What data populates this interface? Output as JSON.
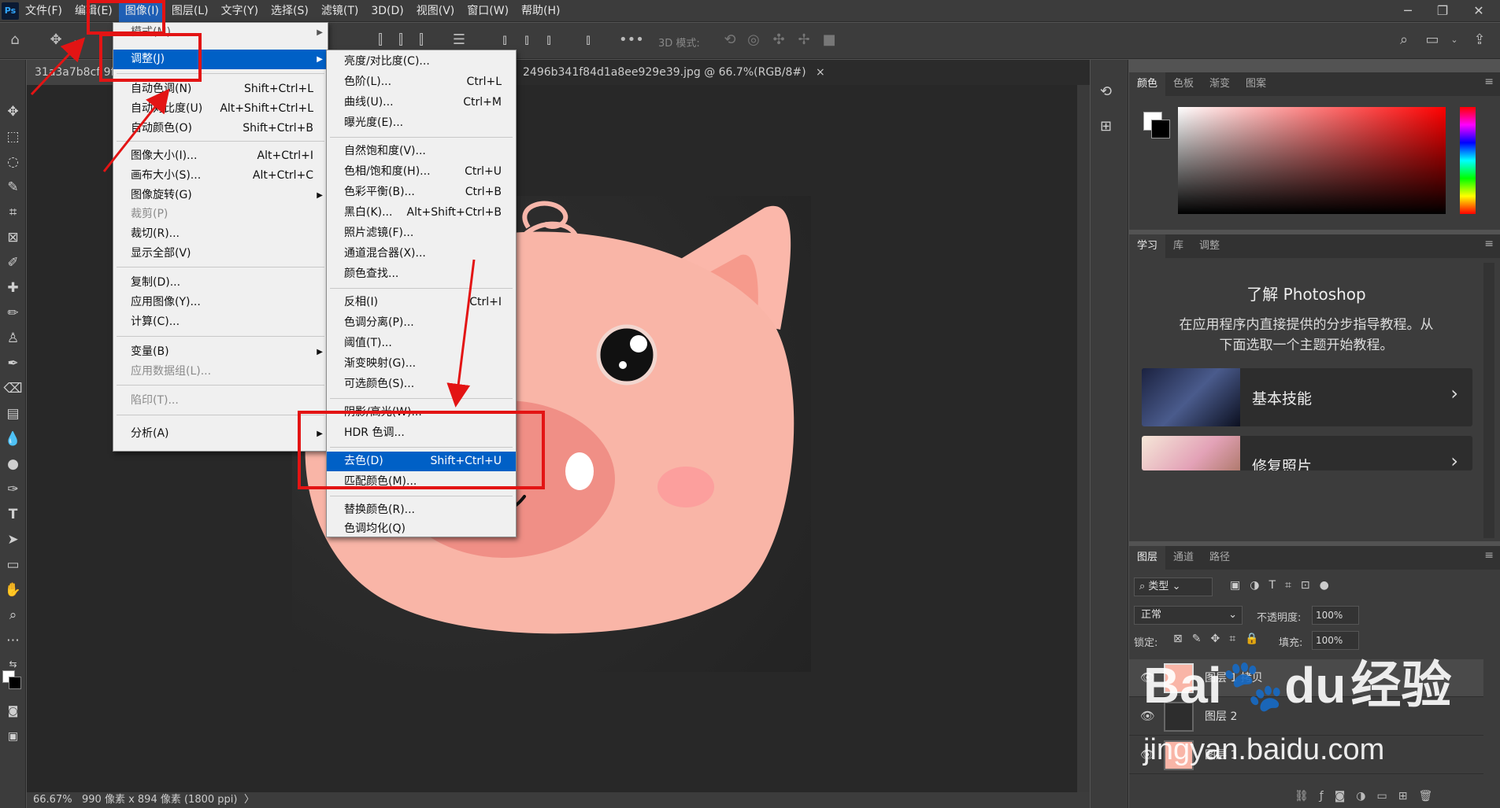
{
  "menubar": {
    "logo": "Ps",
    "items": [
      "文件(F)",
      "编辑(E)",
      "图像(I)",
      "图层(L)",
      "文字(Y)",
      "选择(S)",
      "滤镜(T)",
      "3D(D)",
      "视图(V)",
      "窗口(W)",
      "帮助(H)"
    ],
    "active_index": 2
  },
  "window_controls": [
    "─",
    "❐",
    "✕"
  ],
  "options": {
    "three_d_mode_label": "3D 模式:"
  },
  "tabs": {
    "left_tab": "31a3a7b8cf 9f",
    "doc_tab": "2496b341f84d1a8ee929e39.jpg @ 66.7%(RGB/8#)",
    "close": "×"
  },
  "status": {
    "zoom": "66.67%",
    "info": "990 像素 x 894 像素 (1800 ppi)",
    "arrow": "〉"
  },
  "image_menu": {
    "mode_label": "模式(M)",
    "adjust_label": "调整(J)",
    "items": [
      {
        "label": "自动色调(N)",
        "shortcut": "Shift+Ctrl+L"
      },
      {
        "label": "自动对比度(U)",
        "shortcut": "Alt+Shift+Ctrl+L"
      },
      {
        "label": "自动颜色(O)",
        "shortcut": "Shift+Ctrl+B"
      },
      {
        "label": "图像大小(I)...",
        "shortcut": "Alt+Ctrl+I"
      },
      {
        "label": "画布大小(S)...",
        "shortcut": "Alt+Ctrl+C"
      },
      {
        "label": "图像旋转(G)",
        "shortcut": ""
      },
      {
        "label": "裁剪(P)",
        "shortcut": ""
      },
      {
        "label": "裁切(R)...",
        "shortcut": ""
      },
      {
        "label": "显示全部(V)",
        "shortcut": ""
      },
      {
        "label": "复制(D)...",
        "shortcut": ""
      },
      {
        "label": "应用图像(Y)...",
        "shortcut": ""
      },
      {
        "label": "计算(C)...",
        "shortcut": ""
      },
      {
        "label": "变量(B)",
        "shortcut": ""
      },
      {
        "label": "应用数据组(L)...",
        "shortcut": ""
      },
      {
        "label": "陷印(T)...",
        "shortcut": ""
      },
      {
        "label": "分析(A)",
        "shortcut": ""
      }
    ]
  },
  "adjust_menu": {
    "items": [
      {
        "label": "亮度/对比度(C)...",
        "shortcut": ""
      },
      {
        "label": "色阶(L)...",
        "shortcut": "Ctrl+L"
      },
      {
        "label": "曲线(U)...",
        "shortcut": "Ctrl+M"
      },
      {
        "label": "曝光度(E)...",
        "shortcut": ""
      },
      {
        "label": "自然饱和度(V)...",
        "shortcut": ""
      },
      {
        "label": "色相/饱和度(H)...",
        "shortcut": "Ctrl+U"
      },
      {
        "label": "色彩平衡(B)...",
        "shortcut": "Ctrl+B"
      },
      {
        "label": "黑白(K)...",
        "shortcut": "Alt+Shift+Ctrl+B"
      },
      {
        "label": "照片滤镜(F)...",
        "shortcut": ""
      },
      {
        "label": "通道混合器(X)...",
        "shortcut": ""
      },
      {
        "label": "颜色查找...",
        "shortcut": ""
      },
      {
        "label": "反相(I)",
        "shortcut": "Ctrl+I"
      },
      {
        "label": "色调分离(P)...",
        "shortcut": ""
      },
      {
        "label": "阈值(T)...",
        "shortcut": ""
      },
      {
        "label": "渐变映射(G)...",
        "shortcut": ""
      },
      {
        "label": "可选颜色(S)...",
        "shortcut": ""
      },
      {
        "label": "阴影/高光(W)...",
        "shortcut": ""
      },
      {
        "label": "HDR 色调...",
        "shortcut": ""
      },
      {
        "label": "去色(D)",
        "shortcut": "Shift+Ctrl+U"
      },
      {
        "label": "匹配颜色(M)...",
        "shortcut": ""
      },
      {
        "label": "替换颜色(R)...",
        "shortcut": ""
      },
      {
        "label": "色调均化(Q)",
        "shortcut": ""
      }
    ]
  },
  "color_panel": {
    "tabs": [
      "颜色",
      "色板",
      "渐变",
      "图案"
    ]
  },
  "learn_panel": {
    "tabs": [
      "学习",
      "库",
      "调整"
    ],
    "title": "了解 Photoshop",
    "desc_line1": "在应用程序内直接提供的分步指导教程。从",
    "desc_line2": "下面选取一个主题开始教程。",
    "cards": [
      "基本技能",
      "修复照片"
    ]
  },
  "layers_panel": {
    "tabs": [
      "图层",
      "通道",
      "路径"
    ],
    "filter_label": "类型",
    "blend_mode": "正常",
    "opacity_label": "不透明度:",
    "opacity_value": "100%",
    "lock_label": "锁定:",
    "fill_label": "填充:",
    "fill_value": "100%",
    "layers": [
      {
        "name": "图层 1 拷贝"
      },
      {
        "name": "图层 2"
      },
      {
        "name": "图层 1"
      }
    ]
  },
  "watermark": {
    "brand1": "Bai",
    "brand2": "du",
    "brand3": "经验",
    "url": "jingyan.baidu.com"
  },
  "colors": {
    "accent": "#0060c6",
    "annotation": "#e31414",
    "pig_skin": "#f9b5a7"
  }
}
